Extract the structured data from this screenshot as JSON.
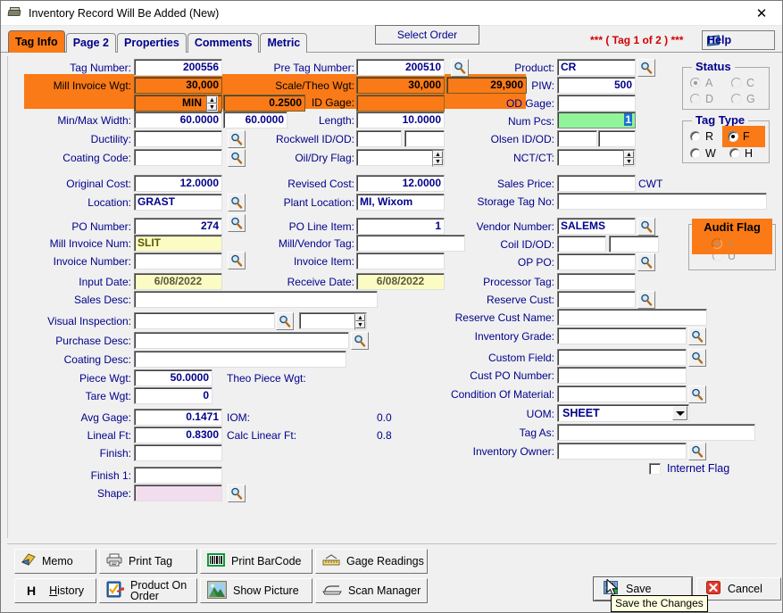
{
  "window": {
    "title": "Inventory Record Will Be Added  (New)",
    "close_label": "✕",
    "icon": "inventory-icon"
  },
  "tabs": [
    {
      "label": "Tag Info",
      "active": true
    },
    {
      "label": "Page 2",
      "active": false
    },
    {
      "label": "Properties",
      "active": false
    },
    {
      "label": "Comments",
      "active": false
    },
    {
      "label": "Metric",
      "active": false
    }
  ],
  "header": {
    "select_order": "Select Order",
    "tag_count": "***  ( Tag 1 of 2 )  ***",
    "help": "Help"
  },
  "colors": {
    "highlight_orange": "#FA7A17",
    "required_yellow": "#FBFBC4",
    "focus_green": "#90F59A",
    "shape_pink": "#F2DDEE",
    "label_blue": "#00008B",
    "tag_count_red": "#D00000"
  },
  "left_column": {
    "tag_number": {
      "label": "Tag Number:",
      "value": "200556"
    },
    "mill_invoice_wgt": {
      "label": "Mill Invoice Wgt:",
      "value": "30,000"
    },
    "min_selector": {
      "label": "MIN",
      "value": "0.2500"
    },
    "min_max_width": {
      "label": "Min/Max Width:",
      "value": "60.0000",
      "value2": "60.0000"
    },
    "ductility": {
      "label": "Ductility:",
      "value": ""
    },
    "coating_code": {
      "label": "Coating Code:",
      "value": ""
    },
    "original_cost": {
      "label": "Original Cost:",
      "value": "12.0000"
    },
    "location": {
      "label": "Location:",
      "value": "GRAST"
    },
    "po_number": {
      "label": "PO Number:",
      "value": "274"
    },
    "mill_invoice_num": {
      "label": "Mill Invoice Num:",
      "value": "SLIT"
    },
    "invoice_number": {
      "label": "Invoice Number:",
      "value": ""
    },
    "input_date": {
      "label": "Input Date:",
      "value": "6/08/2022"
    },
    "sales_desc": {
      "label": "Sales Desc:",
      "value": ""
    },
    "visual_inspection": {
      "label": "Visual Inspection:",
      "value": "",
      "value2": ""
    },
    "purchase_desc": {
      "label": "Purchase Desc:",
      "value": ""
    },
    "coating_desc": {
      "label": "Coating Desc:",
      "value": ""
    },
    "piece_wgt": {
      "label": "Piece Wgt:",
      "value": "50.0000"
    },
    "theo_piece_wgt": {
      "label": "Theo Piece Wgt:",
      "value": ""
    },
    "tare_wgt": {
      "label": "Tare Wgt:",
      "value": "0"
    },
    "avg_gage": {
      "label": "Avg Gage:",
      "value": "0.1471"
    },
    "iom": {
      "label": "IOM:",
      "value": "0.0"
    },
    "lineal_ft": {
      "label": "Lineal Ft:",
      "value": "0.8300"
    },
    "calc_linear_ft": {
      "label": "Calc Linear Ft:",
      "value": "0.8"
    },
    "finish": {
      "label": "Finish:",
      "value": ""
    },
    "finish_1": {
      "label": "Finish 1:",
      "value": ""
    },
    "shape": {
      "label": "Shape:",
      "value": ""
    }
  },
  "middle_column": {
    "pre_tag_number": {
      "label": "Pre Tag Number:",
      "value": "200510"
    },
    "scale_theo_wgt": {
      "label": "Scale/Theo Wgt:",
      "value": "30,000",
      "value2": "29,900"
    },
    "id_gage": {
      "label": "ID Gage:",
      "value": ""
    },
    "length": {
      "label": "Length:",
      "value": "10.0000"
    },
    "rockwell_id_od": {
      "label": "Rockwell ID/OD:",
      "value": "",
      "value2": ""
    },
    "oil_dry_flag": {
      "label": "Oil/Dry Flag:",
      "value": ""
    },
    "revised_cost": {
      "label": "Revised Cost:",
      "value": "12.0000"
    },
    "plant_location": {
      "label": "Plant Location:",
      "value": "MI, Wixom"
    },
    "po_line_item": {
      "label": "PO Line Item:",
      "value": "1"
    },
    "mill_vendor_tag": {
      "label": "Mill/Vendor Tag:",
      "value": ""
    },
    "invoice_item": {
      "label": "Invoice Item:",
      "value": ""
    },
    "receive_date": {
      "label": "Receive Date:",
      "value": "6/08/2022"
    }
  },
  "right_column": {
    "product": {
      "label": "Product:",
      "value": "CR"
    },
    "piw": {
      "label": "PIW:",
      "value": "500"
    },
    "od_gage": {
      "label": "OD Gage:",
      "value": ""
    },
    "num_pcs": {
      "label": "Num Pcs:",
      "value": "1"
    },
    "olsen_id_od": {
      "label": "Olsen ID/OD:",
      "value": "",
      "value2": ""
    },
    "nct_ct": {
      "label": "NCT/CT:",
      "value": ""
    },
    "sales_price": {
      "label": "Sales Price:",
      "value": "",
      "unit": "CWT"
    },
    "storage_tag_no": {
      "label": "Storage Tag No:",
      "value": ""
    },
    "vendor_number": {
      "label": "Vendor Number:",
      "value": "SALEMS"
    },
    "coil_id_od": {
      "label": "Coil ID/OD:",
      "value": "",
      "value2": ""
    },
    "op_po": {
      "label": "OP PO:",
      "value": ""
    },
    "processor_tag": {
      "label": "Processor Tag:",
      "value": ""
    },
    "reserve_cust": {
      "label": "Reserve Cust:",
      "value": ""
    },
    "reserve_cust_name": {
      "label": "Reserve Cust Name:",
      "value": ""
    },
    "inventory_grade": {
      "label": "Inventory Grade:",
      "value": ""
    },
    "custom_field": {
      "label": "Custom Field:",
      "value": ""
    },
    "cust_po_number": {
      "label": "Cust PO Number:",
      "value": ""
    },
    "condition_of_material": {
      "label": "Condition Of Material:",
      "value": ""
    },
    "uom": {
      "label": "UOM:",
      "value": "SHEET"
    },
    "tag_as": {
      "label": "Tag As:",
      "value": ""
    },
    "inventory_owner": {
      "label": "Inventory Owner:",
      "value": ""
    },
    "internet_flag": {
      "label": "Internet Flag",
      "checked": false
    }
  },
  "status_group": {
    "caption": "Status",
    "options": [
      {
        "label": "A",
        "selected": true,
        "disabled": true
      },
      {
        "label": "C",
        "selected": false,
        "disabled": true
      },
      {
        "label": "D",
        "selected": false,
        "disabled": true
      },
      {
        "label": "G",
        "selected": false,
        "disabled": true
      }
    ]
  },
  "tag_type_group": {
    "caption": "Tag Type",
    "options": [
      {
        "label": "R",
        "selected": false,
        "disabled": false
      },
      {
        "label": "F",
        "selected": true,
        "disabled": false,
        "highlighted": true
      },
      {
        "label": "W",
        "selected": false,
        "disabled": false
      },
      {
        "label": "H",
        "selected": false,
        "disabled": false
      }
    ]
  },
  "audit_flag_group": {
    "caption": "Audit Flag",
    "highlighted": true,
    "options": [
      {
        "label": "A",
        "selected": true,
        "disabled": true
      },
      {
        "label": "U",
        "selected": false,
        "disabled": true
      }
    ]
  },
  "toolbar": {
    "buttons": [
      {
        "label": "Memo",
        "icon": "memo-icon"
      },
      {
        "label": "Print Tag",
        "icon": "printer-icon"
      },
      {
        "label": "Print BarCode",
        "icon": "barcode-icon"
      },
      {
        "label": "Gage Readings",
        "icon": "ruler-icon"
      },
      {
        "label": "History",
        "icon": "history-h-icon"
      },
      {
        "label": "Product On Order",
        "icon": "checklist-icon"
      },
      {
        "label": "Show Picture",
        "icon": "picture-icon"
      },
      {
        "label": "Scan Manager",
        "icon": "scanner-icon"
      }
    ]
  },
  "actions": {
    "save": "Save",
    "cancel": "Cancel",
    "save_tooltip": "Save the Changes"
  }
}
